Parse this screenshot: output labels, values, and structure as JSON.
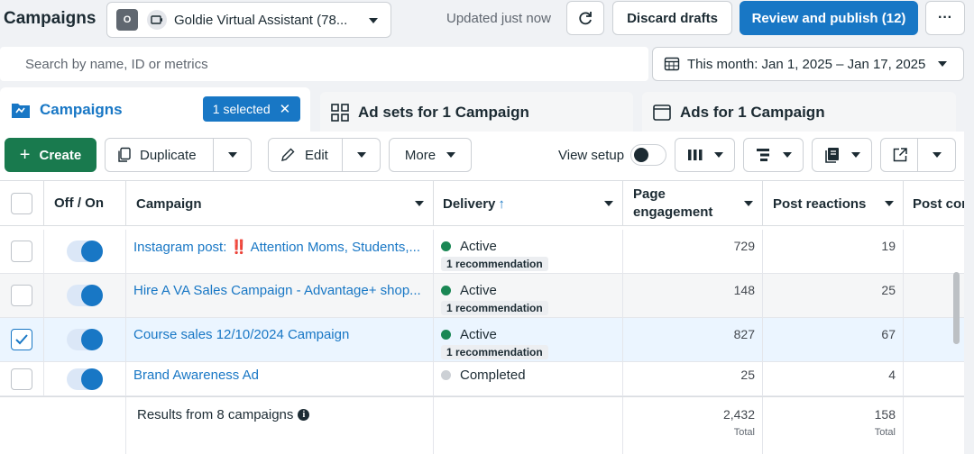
{
  "header": {
    "title": "Campaigns",
    "account_badge": "O",
    "account_name": "Goldie Virtual Assistant (78...",
    "updated": "Updated just now",
    "discard": "Discard drafts",
    "publish": "Review and publish (12)",
    "more": "···"
  },
  "search": {
    "placeholder": "Search by name, ID or metrics"
  },
  "date_range": "This month: Jan 1, 2025 – Jan 17, 2025",
  "tabs": [
    {
      "label": "Campaigns"
    },
    {
      "label": "Ad sets for 1 Campaign"
    },
    {
      "label": "Ads for 1 Campaign"
    }
  ],
  "selected_chip": "1 selected",
  "toolbar": {
    "create": "Create",
    "duplicate": "Duplicate",
    "edit": "Edit",
    "more": "More",
    "view_setup": "View setup"
  },
  "columns": {
    "off_on": "Off / On",
    "campaign": "Campaign",
    "delivery": "Delivery",
    "delivery_arrow": "↑",
    "page_engagement": "Page engagement",
    "post_reactions": "Post reactions",
    "post_comments": "Post cor"
  },
  "rows": [
    {
      "name": "Instagram post: ‼️ Attention Moms, Students,...",
      "status": "Active",
      "recommendation": "1 recommendation",
      "page_engagement": "729",
      "post_reactions": "19",
      "checked": false,
      "on": true
    },
    {
      "name": "Hire A VA Sales Campaign - Advantage+ shop...",
      "status": "Active",
      "recommendation": "1 recommendation",
      "page_engagement": "148",
      "post_reactions": "25",
      "checked": false,
      "on": true
    },
    {
      "name": "Course sales 12/10/2024 Campaign",
      "status": "Active",
      "recommendation": "1 recommendation",
      "page_engagement": "827",
      "post_reactions": "67",
      "checked": true,
      "on": true
    },
    {
      "name": "Brand Awareness Ad",
      "status": "Completed",
      "recommendation": "",
      "page_engagement": "25",
      "post_reactions": "4",
      "checked": false,
      "on": true
    }
  ],
  "footer": {
    "results": "Results from 8 campaigns",
    "page_engagement_total": "2,432",
    "post_reactions_total": "158",
    "total_label": "Total"
  },
  "colors": {
    "active": "#1a8754",
    "completed": "#ccd0d5",
    "accent": "#1877c5",
    "create": "#197a4e"
  }
}
